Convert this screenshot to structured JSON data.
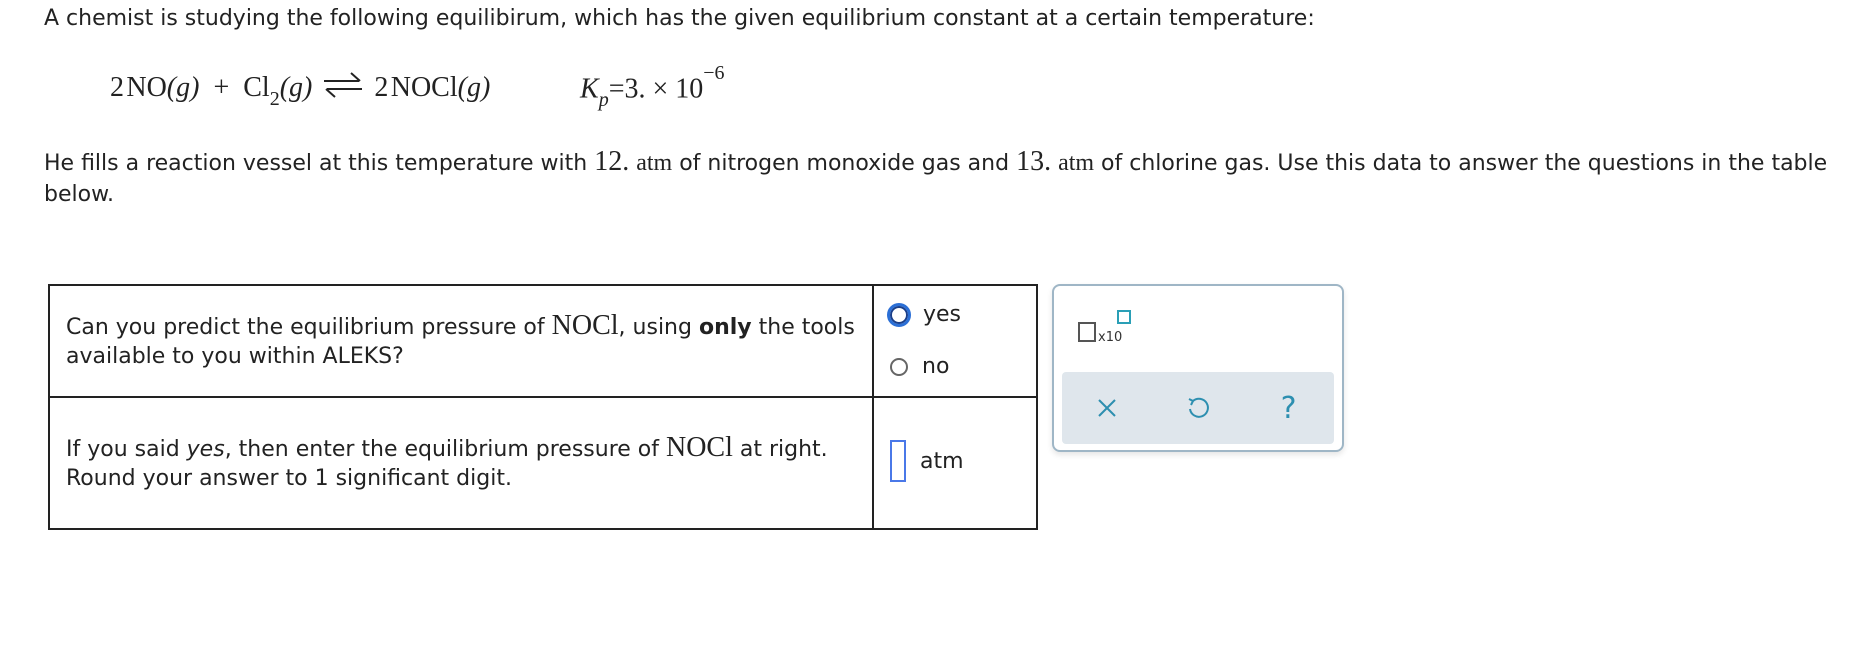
{
  "intro": "A chemist is studying the following equilibirum, which has the given equilibrium constant at a certain temperature:",
  "equation": {
    "lhs_coef1": "2",
    "lhs_species1": "NO",
    "lhs_phase1": "(g)",
    "plus": "+",
    "lhs_species2": "Cl",
    "lhs_sub2": "2",
    "lhs_phase2": "(g)",
    "rhs_coef": "2",
    "rhs_species": "NOCl",
    "rhs_phase": "(g)"
  },
  "kp": {
    "symbol": "K",
    "sub": "p",
    "eq": "=",
    "mantissa": "3.",
    "times": "×",
    "base": "10",
    "exponent": "−6"
  },
  "paragraph": {
    "part1": "He fills a reaction vessel at this temperature with ",
    "value1": "12.",
    "unit1": "atm",
    "part2": " of nitrogen monoxide gas and ",
    "value2": "13.",
    "unit2": "atm",
    "part3": " of chlorine gas. Use this data to answer the questions in the table below."
  },
  "row1": {
    "q_part1": "Can you predict the equilibrium pressure of ",
    "q_formula": "NOCl",
    "q_part2": ", using ",
    "q_bold": "only",
    "q_part3": " the tools available to you within ALEKS?",
    "option_yes": "yes",
    "option_no": "no",
    "selected": "yes"
  },
  "row2": {
    "q_part1": "If you said ",
    "q_italic": "yes",
    "q_part2": ", then enter the equilibrium pressure of ",
    "q_formula": "NOCl",
    "q_part3": " at right. Round your answer to 1 significant digit.",
    "answer_value": "",
    "unit": "atm"
  },
  "tools": {
    "x10_label": "x10",
    "clear_icon": "×",
    "undo_icon": "↺",
    "help_icon": "?"
  }
}
